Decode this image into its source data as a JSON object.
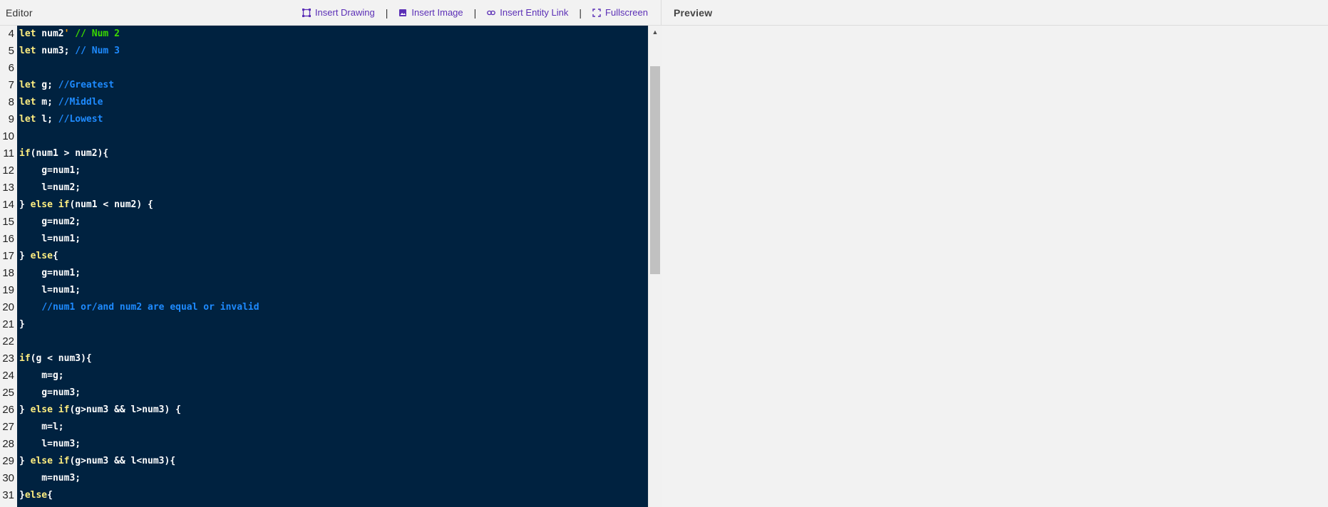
{
  "editor": {
    "title": "Editor",
    "toolbar": {
      "insert_drawing": "Insert Drawing",
      "insert_image": "Insert Image",
      "insert_entity_link": "Insert Entity Link",
      "fullscreen": "Fullscreen",
      "separator": "|"
    },
    "scrollbar": {
      "up_arrow": "▲",
      "scroll_position_fraction": 0.08
    },
    "line_numbers": [
      "4",
      "5",
      "6",
      "7",
      "8",
      "9",
      "10",
      "11",
      "12",
      "13",
      "14",
      "15",
      "16",
      "17",
      "18",
      "19",
      "20",
      "21",
      "22",
      "23",
      "24",
      "25",
      "26",
      "27",
      "28",
      "29",
      "30",
      "31"
    ],
    "code_lines": [
      [
        {
          "t": "let",
          "c": "kw"
        },
        {
          "t": " num2",
          "c": "plain"
        },
        {
          "t": "'",
          "c": "str"
        },
        {
          "t": " // Num 2",
          "c": "cm-green"
        }
      ],
      [
        {
          "t": "let",
          "c": "kw"
        },
        {
          "t": " num3; ",
          "c": "plain"
        },
        {
          "t": "// Num 3",
          "c": "cm"
        }
      ],
      [],
      [
        {
          "t": "let",
          "c": "kw"
        },
        {
          "t": " g; ",
          "c": "plain"
        },
        {
          "t": "//Greatest",
          "c": "cm"
        }
      ],
      [
        {
          "t": "let",
          "c": "kw"
        },
        {
          "t": " m; ",
          "c": "plain"
        },
        {
          "t": "//Middle",
          "c": "cm"
        }
      ],
      [
        {
          "t": "let",
          "c": "kw"
        },
        {
          "t": " l; ",
          "c": "plain"
        },
        {
          "t": "//Lowest",
          "c": "cm"
        }
      ],
      [],
      [
        {
          "t": "if",
          "c": "kw"
        },
        {
          "t": "(num1 > num2){",
          "c": "plain"
        }
      ],
      [
        {
          "t": "    g=num1;",
          "c": "plain"
        }
      ],
      [
        {
          "t": "    l=num2;",
          "c": "plain"
        }
      ],
      [
        {
          "t": "} ",
          "c": "plain"
        },
        {
          "t": "else if",
          "c": "kw"
        },
        {
          "t": "(num1 < num2) {",
          "c": "plain"
        }
      ],
      [
        {
          "t": "    g=num2;",
          "c": "plain"
        }
      ],
      [
        {
          "t": "    l=num1;",
          "c": "plain"
        }
      ],
      [
        {
          "t": "} ",
          "c": "plain"
        },
        {
          "t": "else",
          "c": "kw"
        },
        {
          "t": "{",
          "c": "plain"
        }
      ],
      [
        {
          "t": "    g=num1;",
          "c": "plain"
        }
      ],
      [
        {
          "t": "    l=num1;",
          "c": "plain"
        }
      ],
      [
        {
          "t": "    ",
          "c": "plain"
        },
        {
          "t": "//num1 or/and num2 are equal or invalid",
          "c": "cm"
        }
      ],
      [
        {
          "t": "}",
          "c": "plain"
        }
      ],
      [],
      [
        {
          "t": "if",
          "c": "kw"
        },
        {
          "t": "(g < num3){",
          "c": "plain"
        }
      ],
      [
        {
          "t": "    m=g;",
          "c": "plain"
        }
      ],
      [
        {
          "t": "    g=num3;",
          "c": "plain"
        }
      ],
      [
        {
          "t": "} ",
          "c": "plain"
        },
        {
          "t": "else if",
          "c": "kw"
        },
        {
          "t": "(g>num3 && l>num3) {",
          "c": "plain"
        }
      ],
      [
        {
          "t": "    m=l;",
          "c": "plain"
        }
      ],
      [
        {
          "t": "    l=num3;",
          "c": "plain"
        }
      ],
      [
        {
          "t": "} ",
          "c": "plain"
        },
        {
          "t": "else if",
          "c": "kw"
        },
        {
          "t": "(g>num3 && l<num3){",
          "c": "plain"
        }
      ],
      [
        {
          "t": "    m=num3;",
          "c": "plain"
        }
      ],
      [
        {
          "t": "}",
          "c": "plain"
        },
        {
          "t": "else",
          "c": "kw"
        },
        {
          "t": "{",
          "c": "plain"
        }
      ]
    ],
    "colors": {
      "background": "#002240",
      "keyword": "#ffee80",
      "comment": "#1e8bff",
      "comment_green": "#3ad900",
      "string": "#ff9d00",
      "plain": "#ffffff",
      "toolbar_accent": "#5b2fb6"
    }
  },
  "preview": {
    "title": "Preview"
  }
}
